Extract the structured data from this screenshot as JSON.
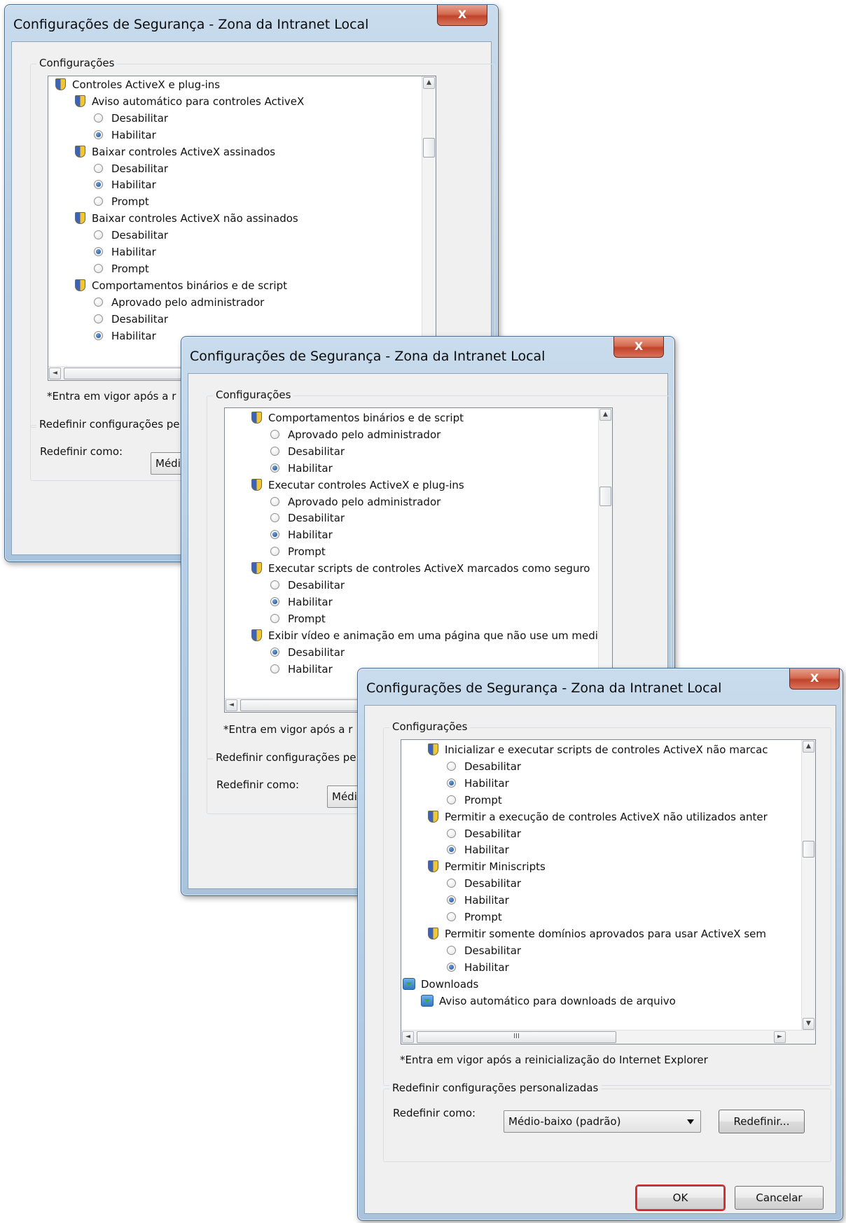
{
  "dialog1": {
    "title": "Configurações de Segurança - Zona da Intranet Local",
    "close_label": "X",
    "group_settings": "Configurações",
    "items": [
      {
        "type": "cat",
        "label": "Controles ActiveX e plug-ins"
      },
      {
        "type": "set",
        "label": "Aviso automático para controles ActiveX"
      },
      {
        "type": "opt",
        "label": "Desabilitar",
        "checked": false
      },
      {
        "type": "opt",
        "label": "Habilitar",
        "checked": true
      },
      {
        "type": "set",
        "label": "Baixar controles ActiveX assinados"
      },
      {
        "type": "opt",
        "label": "Desabilitar",
        "checked": false
      },
      {
        "type": "opt",
        "label": "Habilitar",
        "checked": true
      },
      {
        "type": "opt",
        "label": "Prompt",
        "checked": false
      },
      {
        "type": "set",
        "label": "Baixar controles ActiveX não assinados"
      },
      {
        "type": "opt",
        "label": "Desabilitar",
        "checked": false
      },
      {
        "type": "opt",
        "label": "Habilitar",
        "checked": true
      },
      {
        "type": "opt",
        "label": "Prompt",
        "checked": false
      },
      {
        "type": "set",
        "label": "Comportamentos binários e de script"
      },
      {
        "type": "opt",
        "label": "Aprovado pelo administrador",
        "checked": false
      },
      {
        "type": "opt",
        "label": "Desabilitar",
        "checked": false
      },
      {
        "type": "opt",
        "label": "Habilitar",
        "checked": true
      }
    ],
    "note": "*Entra em vigor após a r",
    "group_reset": "Redefinir configurações pe",
    "reset_as": "Redefinir como:",
    "combo_value": "Médi",
    "hscroll_grip": "III"
  },
  "dialog2": {
    "title": "Configurações de Segurança - Zona da Intranet Local",
    "close_label": "X",
    "group_settings": "Configurações",
    "items": [
      {
        "type": "set",
        "label": "Comportamentos binários e de script"
      },
      {
        "type": "opt",
        "label": "Aprovado pelo administrador",
        "checked": false
      },
      {
        "type": "opt",
        "label": "Desabilitar",
        "checked": false
      },
      {
        "type": "opt",
        "label": "Habilitar",
        "checked": true
      },
      {
        "type": "set",
        "label": "Executar controles ActiveX e plug-ins"
      },
      {
        "type": "opt",
        "label": "Aprovado pelo administrador",
        "checked": false
      },
      {
        "type": "opt",
        "label": "Desabilitar",
        "checked": false
      },
      {
        "type": "opt",
        "label": "Habilitar",
        "checked": true
      },
      {
        "type": "opt",
        "label": "Prompt",
        "checked": false
      },
      {
        "type": "set",
        "label": "Executar scripts de controles ActiveX marcados como seguro"
      },
      {
        "type": "opt",
        "label": "Desabilitar",
        "checked": false
      },
      {
        "type": "opt",
        "label": "Habilitar",
        "checked": true
      },
      {
        "type": "opt",
        "label": "Prompt",
        "checked": false
      },
      {
        "type": "set",
        "label": "Exibir vídeo e animação em uma página que não use um medi"
      },
      {
        "type": "opt",
        "label": "Desabilitar",
        "checked": true
      },
      {
        "type": "opt",
        "label": "Habilitar",
        "checked": false
      }
    ],
    "note": "*Entra em vigor após a r",
    "group_reset": "Redefinir configurações pe",
    "reset_as": "Redefinir como:",
    "combo_value": "Médi",
    "hscroll_grip": "III"
  },
  "dialog3": {
    "title": "Configurações de Segurança - Zona da Intranet Local",
    "close_label": "X",
    "group_settings": "Configurações",
    "items": [
      {
        "type": "set",
        "label": "Inicializar e executar scripts de controles ActiveX não marcac"
      },
      {
        "type": "opt",
        "label": "Desabilitar",
        "checked": false
      },
      {
        "type": "opt",
        "label": "Habilitar",
        "checked": true
      },
      {
        "type": "opt",
        "label": "Prompt",
        "checked": false
      },
      {
        "type": "set",
        "label": "Permitir a execução de controles ActiveX não utilizados anter"
      },
      {
        "type": "opt",
        "label": "Desabilitar",
        "checked": false
      },
      {
        "type": "opt",
        "label": "Habilitar",
        "checked": true
      },
      {
        "type": "set",
        "label": "Permitir Miniscripts"
      },
      {
        "type": "opt",
        "label": "Desabilitar",
        "checked": false
      },
      {
        "type": "opt",
        "label": "Habilitar",
        "checked": true
      },
      {
        "type": "opt",
        "label": "Prompt",
        "checked": false
      },
      {
        "type": "set",
        "label": "Permitir somente domínios aprovados para usar ActiveX sem"
      },
      {
        "type": "opt",
        "label": "Desabilitar",
        "checked": false
      },
      {
        "type": "opt",
        "label": "Habilitar",
        "checked": true
      },
      {
        "type": "dlcat",
        "label": "Downloads"
      },
      {
        "type": "dlset",
        "label": "Aviso automático para downloads de arquivo"
      }
    ],
    "note": "*Entra em vigor após a reinicialização do Internet Explorer",
    "group_reset": "Redefinir configurações personalizadas",
    "reset_as": "Redefinir como:",
    "combo_value": "Médio-baixo (padrão)",
    "reset_button": "Redefinir...",
    "ok_button": "OK",
    "cancel_button": "Cancelar",
    "hscroll_grip": "III"
  }
}
